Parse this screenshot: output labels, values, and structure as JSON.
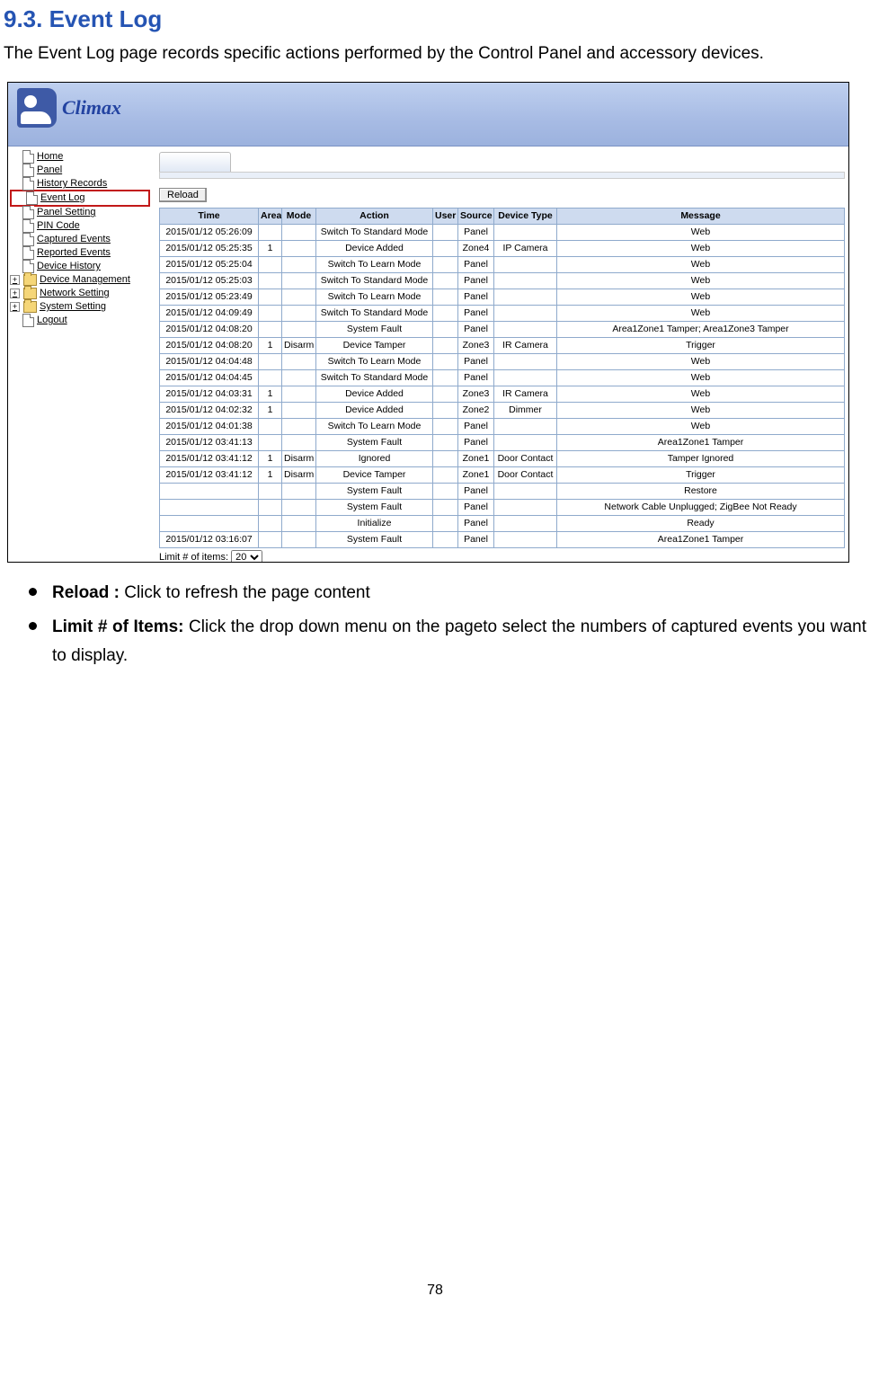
{
  "heading": "9.3. Event Log",
  "intro": "The Event Log page records specific actions performed by the Control Panel and accessory devices.",
  "logo": "Climax",
  "nav": [
    {
      "label": "Home",
      "type": "doc"
    },
    {
      "label": "Panel",
      "type": "doc"
    },
    {
      "label": "History Records",
      "type": "doc"
    },
    {
      "label": "Event Log",
      "type": "doc",
      "hl": true
    },
    {
      "label": "Panel Setting",
      "type": "doc"
    },
    {
      "label": "PIN Code",
      "type": "doc"
    },
    {
      "label": "Captured Events",
      "type": "doc"
    },
    {
      "label": "Reported Events",
      "type": "doc"
    },
    {
      "label": "Device History",
      "type": "doc"
    },
    {
      "label": "Device Management",
      "type": "fld",
      "plus": true
    },
    {
      "label": "Network Setting",
      "type": "fld",
      "plus": true
    },
    {
      "label": "System Setting",
      "type": "fld",
      "plus": true
    },
    {
      "label": "Logout",
      "type": "doc"
    }
  ],
  "reloadBtn": "Reload",
  "tableHeaders": [
    "Time",
    "Area",
    "Mode",
    "Action",
    "User",
    "Source",
    "Device Type",
    "Message"
  ],
  "colWidths": [
    "110",
    "26",
    "38",
    "130",
    "28",
    "40",
    "70",
    "auto"
  ],
  "rows": [
    [
      "2015/01/12 05:26:09",
      "",
      "",
      "Switch To Standard Mode",
      "",
      "Panel",
      "",
      "Web"
    ],
    [
      "2015/01/12 05:25:35",
      "1",
      "",
      "Device Added",
      "",
      "Zone4",
      "IP Camera",
      "Web"
    ],
    [
      "2015/01/12 05:25:04",
      "",
      "",
      "Switch To Learn Mode",
      "",
      "Panel",
      "",
      "Web"
    ],
    [
      "2015/01/12 05:25:03",
      "",
      "",
      "Switch To Standard Mode",
      "",
      "Panel",
      "",
      "Web"
    ],
    [
      "2015/01/12 05:23:49",
      "",
      "",
      "Switch To Learn Mode",
      "",
      "Panel",
      "",
      "Web"
    ],
    [
      "2015/01/12 04:09:49",
      "",
      "",
      "Switch To Standard Mode",
      "",
      "Panel",
      "",
      "Web"
    ],
    [
      "2015/01/12 04:08:20",
      "",
      "",
      "System Fault",
      "",
      "Panel",
      "",
      "Area1Zone1 Tamper; Area1Zone3 Tamper"
    ],
    [
      "2015/01/12 04:08:20",
      "1",
      "Disarm",
      "Device Tamper",
      "",
      "Zone3",
      "IR Camera",
      "Trigger"
    ],
    [
      "2015/01/12 04:04:48",
      "",
      "",
      "Switch To Learn Mode",
      "",
      "Panel",
      "",
      "Web"
    ],
    [
      "2015/01/12 04:04:45",
      "",
      "",
      "Switch To Standard Mode",
      "",
      "Panel",
      "",
      "Web"
    ],
    [
      "2015/01/12 04:03:31",
      "1",
      "",
      "Device Added",
      "",
      "Zone3",
      "IR Camera",
      "Web"
    ],
    [
      "2015/01/12 04:02:32",
      "1",
      "",
      "Device Added",
      "",
      "Zone2",
      "Dimmer",
      "Web"
    ],
    [
      "2015/01/12 04:01:38",
      "",
      "",
      "Switch To Learn Mode",
      "",
      "Panel",
      "",
      "Web"
    ],
    [
      "2015/01/12 03:41:13",
      "",
      "",
      "System Fault",
      "",
      "Panel",
      "",
      "Area1Zone1 Tamper"
    ],
    [
      "2015/01/12 03:41:12",
      "1",
      "Disarm",
      "Ignored",
      "",
      "Zone1",
      "Door Contact",
      "Tamper Ignored"
    ],
    [
      "2015/01/12 03:41:12",
      "1",
      "Disarm",
      "Device Tamper",
      "",
      "Zone1",
      "Door Contact",
      "Trigger"
    ],
    [
      "",
      "",
      "",
      "System Fault",
      "",
      "Panel",
      "",
      "Restore"
    ],
    [
      "",
      "",
      "",
      "System Fault",
      "",
      "Panel",
      "",
      "Network Cable Unplugged; ZigBee Not Ready"
    ],
    [
      "",
      "",
      "",
      "Initialize",
      "",
      "Panel",
      "",
      "Ready"
    ],
    [
      "2015/01/12 03:16:07",
      "",
      "",
      "System Fault",
      "",
      "Panel",
      "",
      "Area1Zone1 Tamper"
    ]
  ],
  "limitLabel": "Limit # of items:",
  "limitValue": "20",
  "bullets": [
    {
      "b": "Reload :",
      "t": " Click to refresh the page content"
    },
    {
      "b": "Limit # of Items:",
      "t": " Click the drop down menu on the pageto select the numbers of captured events you want to display."
    }
  ],
  "pageNumber": "78"
}
